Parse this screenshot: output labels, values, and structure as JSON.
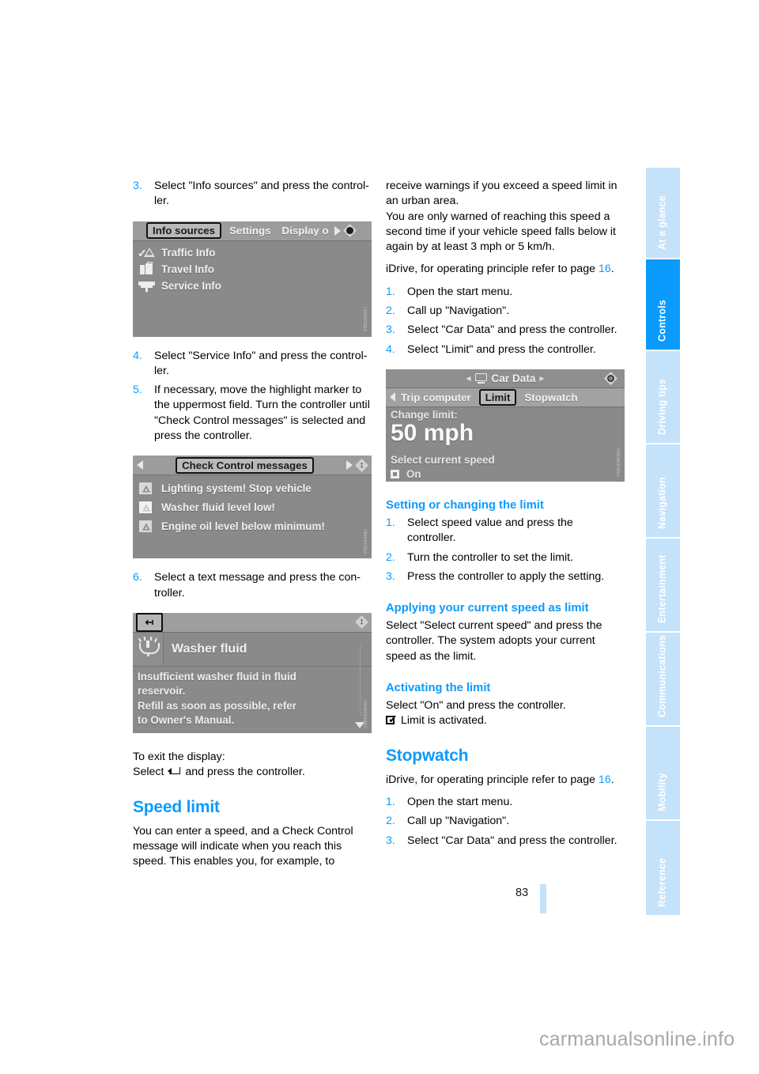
{
  "page": {
    "number": "83",
    "watermark": "carmanualsonline.info"
  },
  "sidebar": {
    "tabs": [
      {
        "label": "At a glance",
        "active": false
      },
      {
        "label": "Controls",
        "active": true
      },
      {
        "label": "Driving tips",
        "active": false
      },
      {
        "label": "Navigation",
        "active": false
      },
      {
        "label": "Entertainment",
        "active": false
      },
      {
        "label": "Communications",
        "active": false
      },
      {
        "label": "Mobility",
        "active": false
      },
      {
        "label": "Reference",
        "active": false
      }
    ]
  },
  "left_column": {
    "step3": {
      "num": "3.",
      "text": "Select \"Info sources\" and press the control-ler."
    },
    "screenshot_info_sources": {
      "code": "VSD1D402J",
      "bar": {
        "selected_tab": "Info sources",
        "tab2": "Settings",
        "tab3": "Display o"
      },
      "rows": [
        {
          "label": "Traffic Info",
          "icon": "check-warning-icon"
        },
        {
          "label": "Travel Info",
          "icon": "luggage-icon"
        },
        {
          "label": "Service Info",
          "icon": "service-icon"
        }
      ]
    },
    "step4": {
      "num": "4.",
      "text": "Select \"Service Info\" and press the control-ler."
    },
    "step5": {
      "num": "5.",
      "text": "If necessary, move the highlight marker to the uppermost field. Turn the controller until \"Check Control messages\" is selected and press the controller."
    },
    "screenshot_check_control": {
      "code": "VSD1D408J",
      "bar": {
        "selected_tab": "Check Control messages"
      },
      "rows": [
        {
          "label": "Lighting system! Stop vehicle",
          "icon": "warning-triangle-icon"
        },
        {
          "label": "Washer fluid level low!",
          "icon": "warning-triangle-light-icon"
        },
        {
          "label": "Engine oil level below minimum!",
          "icon": "warning-triangle-icon"
        }
      ]
    },
    "step6": {
      "num": "6.",
      "text": "Select a text message and press the con-troller."
    },
    "screenshot_washer_fluid": {
      "code": "VSD0A345MJ",
      "title": "Washer fluid",
      "title_icon": "washer-fluid-icon",
      "message_lines": [
        "Insufficient washer fluid in fluid",
        "reservoir.",
        "Refill as soon as possible, refer",
        "to Owner's Manual."
      ]
    },
    "exit_label": "To exit the display:",
    "exit_text_before": "Select",
    "exit_text_after": "and press the controller.",
    "speed_limit_heading": "Speed limit",
    "speed_limit_body": "You can enter a speed, and a Check Control message will indicate when you reach this speed. This enables you, for example, to"
  },
  "right_column": {
    "intro_para1": "receive warnings if you exceed a speed limit in an urban area.",
    "intro_para2": "You are only warned of reaching this speed a second time if your vehicle speed falls below it again by at least 3 mph or 5 km/h.",
    "idrive_note_before": "iDrive, for operating principle refer to page",
    "idrive_note_page": "16",
    "idrive_note_after": ".",
    "steps": [
      {
        "num": "1.",
        "text": "Open the start menu."
      },
      {
        "num": "2.",
        "text": "Call up \"Navigation\"."
      },
      {
        "num": "3.",
        "text": "Select \"Car Data\" and press the controller."
      },
      {
        "num": "4.",
        "text": "Select \"Limit\" and press the controller."
      }
    ],
    "screenshot_car_data": {
      "code": "VSD1D403MJ",
      "header_title": "Car Data",
      "header_icon": "display-icon",
      "tabs": [
        "Trip computer",
        "Limit",
        "Stopwatch"
      ],
      "selected_tab": "Limit",
      "change_limit_label": "Change limit:",
      "limit_value": "50 mph",
      "select_current_speed": "Select current speed",
      "on_label": "On"
    },
    "setting_heading": "Setting or changing the limit",
    "setting_steps": [
      {
        "num": "1.",
        "text": "Select speed value and press the controller."
      },
      {
        "num": "2.",
        "text": "Turn the controller to set the limit."
      },
      {
        "num": "3.",
        "text": "Press the controller to apply the setting."
      }
    ],
    "applying_heading": "Applying your current speed as limit",
    "applying_body": "Select \"Select current speed\" and press the controller. The system adopts your current speed as the limit.",
    "activating_heading": "Activating the limit",
    "activating_body": "Select \"On\" and press the controller.",
    "activating_note": "Limit is activated.",
    "stopwatch_heading": "Stopwatch",
    "stopwatch_note_before": "iDrive, for operating principle refer to page",
    "stopwatch_note_page": "16",
    "stopwatch_note_after": ".",
    "stopwatch_steps": [
      {
        "num": "1.",
        "text": "Open the start menu."
      },
      {
        "num": "2.",
        "text": "Call up \"Navigation\"."
      },
      {
        "num": "3.",
        "text": "Select \"Car Data\" and press the controller."
      }
    ]
  },
  "colors": {
    "accent": "#0a9bfc",
    "sidebar_inactive": "#c5e2fb",
    "screen_bg": "#8a8a8a"
  }
}
